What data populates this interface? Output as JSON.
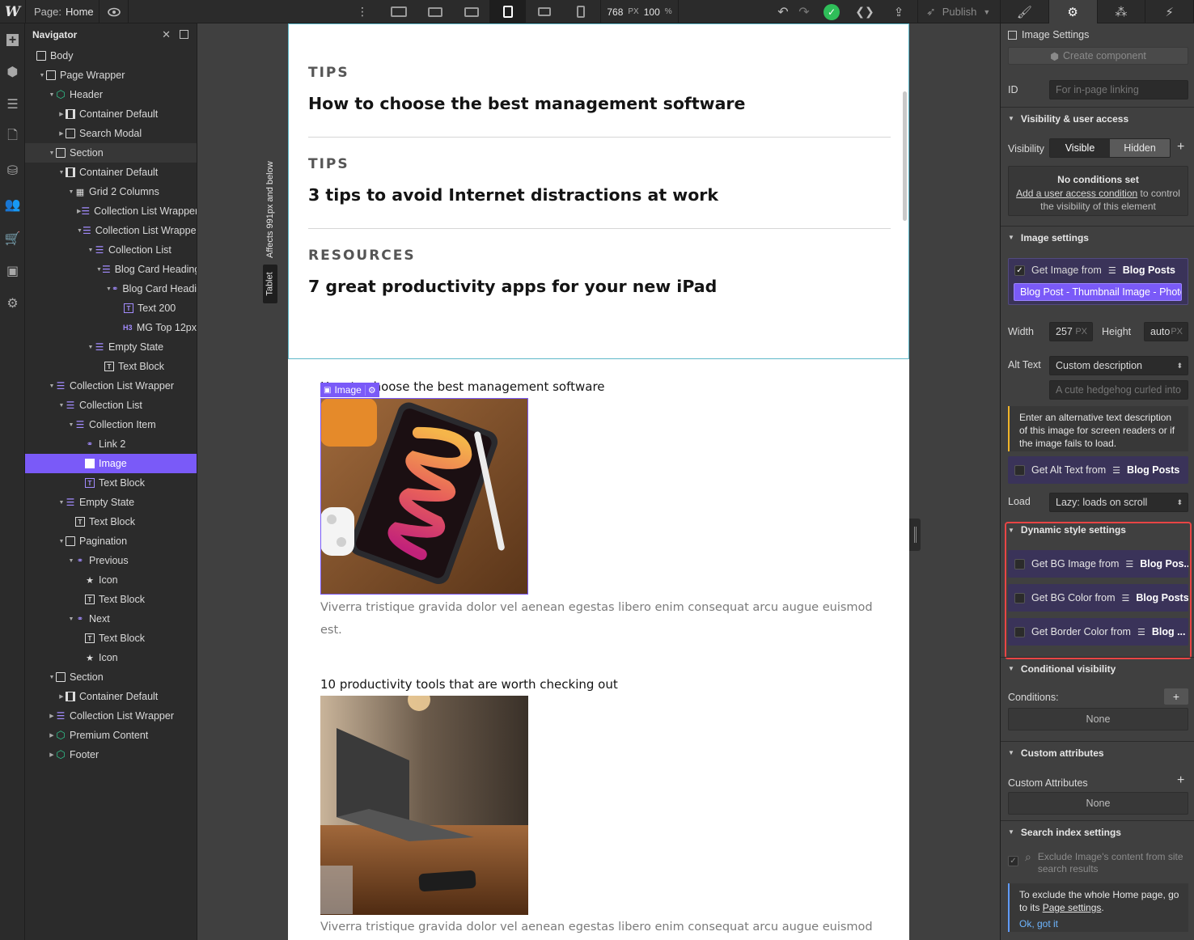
{
  "topbar": {
    "page_label": "Page:",
    "page_name": "Home",
    "viewport_width": "768",
    "viewport_unit": "PX",
    "zoom": "100",
    "zoom_unit": "%",
    "publish_label": "Publish"
  },
  "navigator": {
    "title": "Navigator",
    "items": [
      {
        "label": "Body"
      },
      {
        "label": "Page Wrapper"
      },
      {
        "label": "Header"
      },
      {
        "label": "Container Default"
      },
      {
        "label": "Search Modal"
      },
      {
        "label": "Section"
      },
      {
        "label": "Container Default"
      },
      {
        "label": "Grid 2 Columns"
      },
      {
        "label": "Collection List Wrapper"
      },
      {
        "label": "Collection List Wrapper"
      },
      {
        "label": "Collection List"
      },
      {
        "label": "Blog Card Heading"
      },
      {
        "label": "Blog Card Heading"
      },
      {
        "label": "Text 200"
      },
      {
        "label": "MG Top 12px"
      },
      {
        "label": "Empty State"
      },
      {
        "label": "Text Block"
      },
      {
        "label": "Collection List Wrapper"
      },
      {
        "label": "Collection List"
      },
      {
        "label": "Collection Item"
      },
      {
        "label": "Link 2"
      },
      {
        "label": "Image"
      },
      {
        "label": "Text Block"
      },
      {
        "label": "Empty State"
      },
      {
        "label": "Text Block"
      },
      {
        "label": "Pagination"
      },
      {
        "label": "Previous"
      },
      {
        "label": "Icon"
      },
      {
        "label": "Text Block"
      },
      {
        "label": "Next"
      },
      {
        "label": "Text Block"
      },
      {
        "label": "Icon"
      },
      {
        "label": "Section"
      },
      {
        "label": "Container Default"
      },
      {
        "label": "Collection List Wrapper"
      },
      {
        "label": "Premium Content"
      },
      {
        "label": "Footer"
      }
    ]
  },
  "canvas": {
    "breakpoint_label": "Tablet",
    "breakpoint_affects": "Affects 991px and below",
    "tips": [
      {
        "category": "TIPS",
        "title": "How to choose the best management software"
      },
      {
        "category": "TIPS",
        "title": "3 tips to avoid Internet distractions at work"
      },
      {
        "category": "RESOURCES",
        "title": "7 great productivity apps for your new iPad"
      }
    ],
    "selected_badge": "Image",
    "items": [
      {
        "title": "How to choose the best management software",
        "description": "Viverra tristique gravida dolor vel aenean egestas libero enim consequat arcu augue euismod est."
      },
      {
        "title": "10 productivity tools that are worth checking out",
        "description": "Viverra tristique gravida dolor vel aenean egestas libero enim consequat arcu augue euismod"
      }
    ]
  },
  "settings": {
    "title": "Image Settings",
    "create_component": "Create component",
    "id_label": "ID",
    "id_placeholder": "For in-page linking",
    "visibility_section": "Visibility & user access",
    "visibility_label": "Visibility",
    "visible_option": "Visible",
    "hidden_option": "Hidden",
    "no_conditions_title": "No conditions set",
    "no_conditions_link": "Add a user access condition",
    "no_conditions_rest": "to control the visibility of this element",
    "image_section": "Image settings",
    "get_image_from": "Get Image from",
    "blog_posts": "Blog Posts",
    "image_field": "Blog Post - Thumbnail Image - Photo",
    "width_label": "Width",
    "width_value": "257",
    "width_unit": "PX",
    "height_label": "Height",
    "height_value": "auto",
    "height_unit": "PX",
    "alt_label": "Alt Text",
    "alt_mode": "Custom description",
    "alt_placeholder": "A cute hedgehog curled into a ball",
    "alt_warning": "Enter an alternative text description of this image for screen readers or if the image fails to load.",
    "get_alt_from": "Get Alt Text from",
    "load_label": "Load",
    "load_value": "Lazy: loads on scroll",
    "dynamic_section": "Dynamic style settings",
    "bg_image": "Get BG Image from",
    "bg_image_src": "Blog Pos...",
    "bg_color": "Get BG Color from",
    "bg_color_src": "Blog Posts",
    "border_color": "Get Border Color from",
    "border_color_src": "Blog ...",
    "conditional_section": "Conditional visibility",
    "conditions_label": "Conditions:",
    "none": "None",
    "custom_attr_section": "Custom attributes",
    "custom_attr_label": "Custom Attributes",
    "search_section": "Search index settings",
    "exclude_label": "Exclude Image's content from site search results",
    "search_info_1": "To exclude the whole Home page, go to its",
    "search_info_link": "Page settings",
    "search_info_ok": "Ok, got it"
  },
  "colors": {
    "accent": "#7a5af8",
    "highlight": "#e84545",
    "success": "#2fbe59"
  }
}
